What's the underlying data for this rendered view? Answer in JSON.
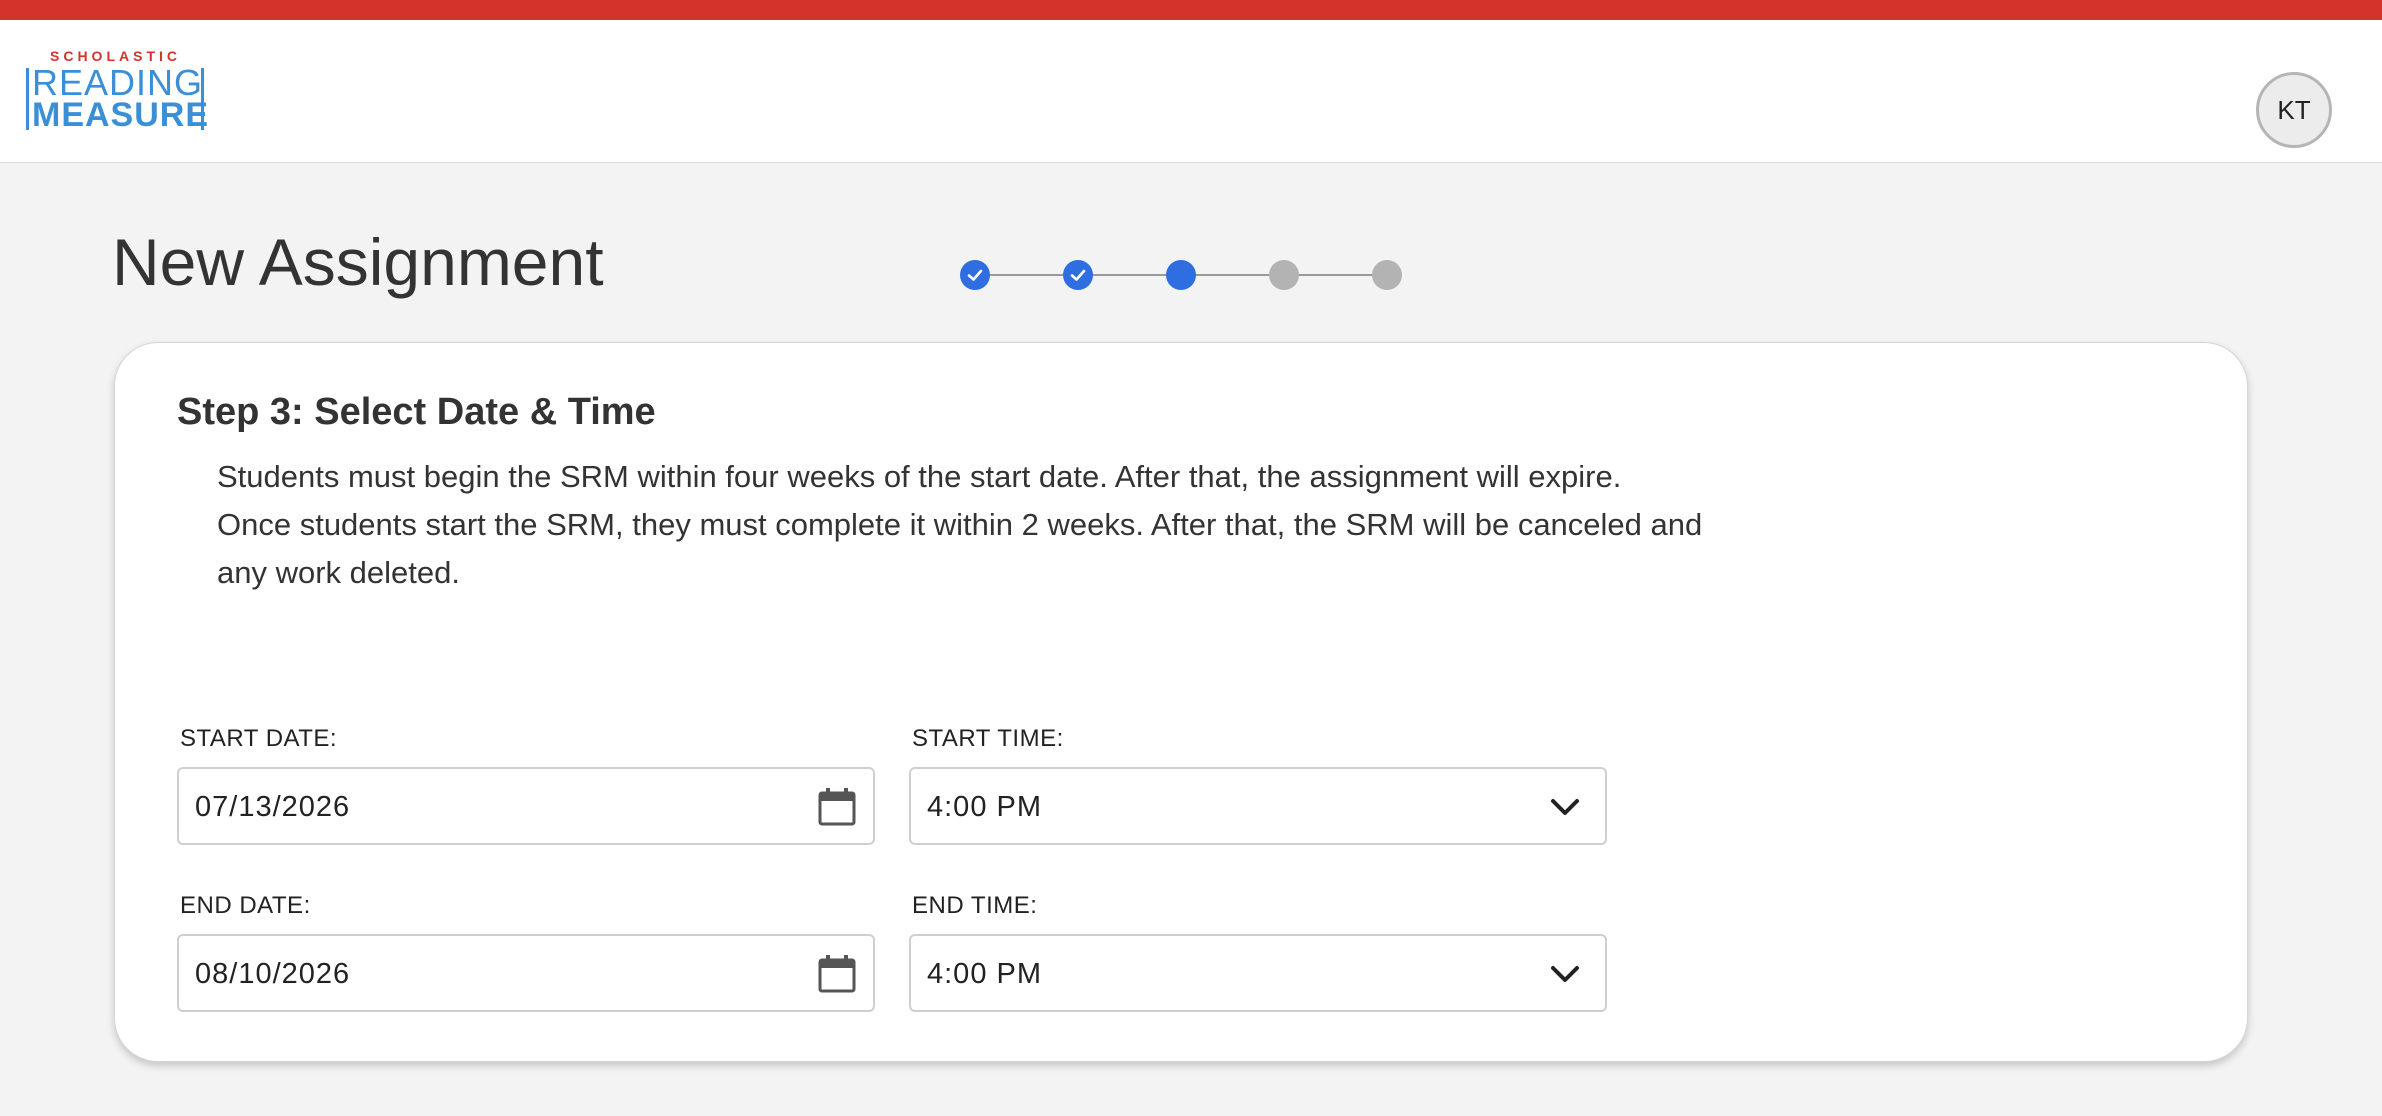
{
  "brand": {
    "top_text": "SCHOLASTIC",
    "line1": "READING",
    "line2": "MEASURE",
    "accent": "#d4332b",
    "logo_blue": "#3a8fd6"
  },
  "user": {
    "initials": "KT"
  },
  "page": {
    "title": "New Assignment"
  },
  "stepper": {
    "steps": [
      {
        "state": "done",
        "icon": "check-icon"
      },
      {
        "state": "done",
        "icon": "check-icon"
      },
      {
        "state": "current"
      },
      {
        "state": "todo"
      },
      {
        "state": "todo"
      }
    ],
    "active_color": "#2e6ee0",
    "inactive_color": "#b3b3b3"
  },
  "card": {
    "heading": "Step 3: Select Date & Time",
    "instruction_1": "Students must begin the SRM within four weeks of the start date. After that, the assignment will expire.",
    "instruction_2": "Once students start the SRM, they must complete it within 2 weeks. After that, the SRM will be canceled and any work deleted."
  },
  "form": {
    "start_date": {
      "label": "START DATE:",
      "value": "07/13/2026",
      "icon": "calendar-icon"
    },
    "start_time": {
      "label": "START TIME:",
      "value": "4:00 PM",
      "icon": "chevron-down-icon"
    },
    "end_date": {
      "label": "END DATE:",
      "value": "08/10/2026",
      "icon": "calendar-icon"
    },
    "end_time": {
      "label": "END TIME:",
      "value": "4:00 PM",
      "icon": "chevron-down-icon"
    }
  }
}
